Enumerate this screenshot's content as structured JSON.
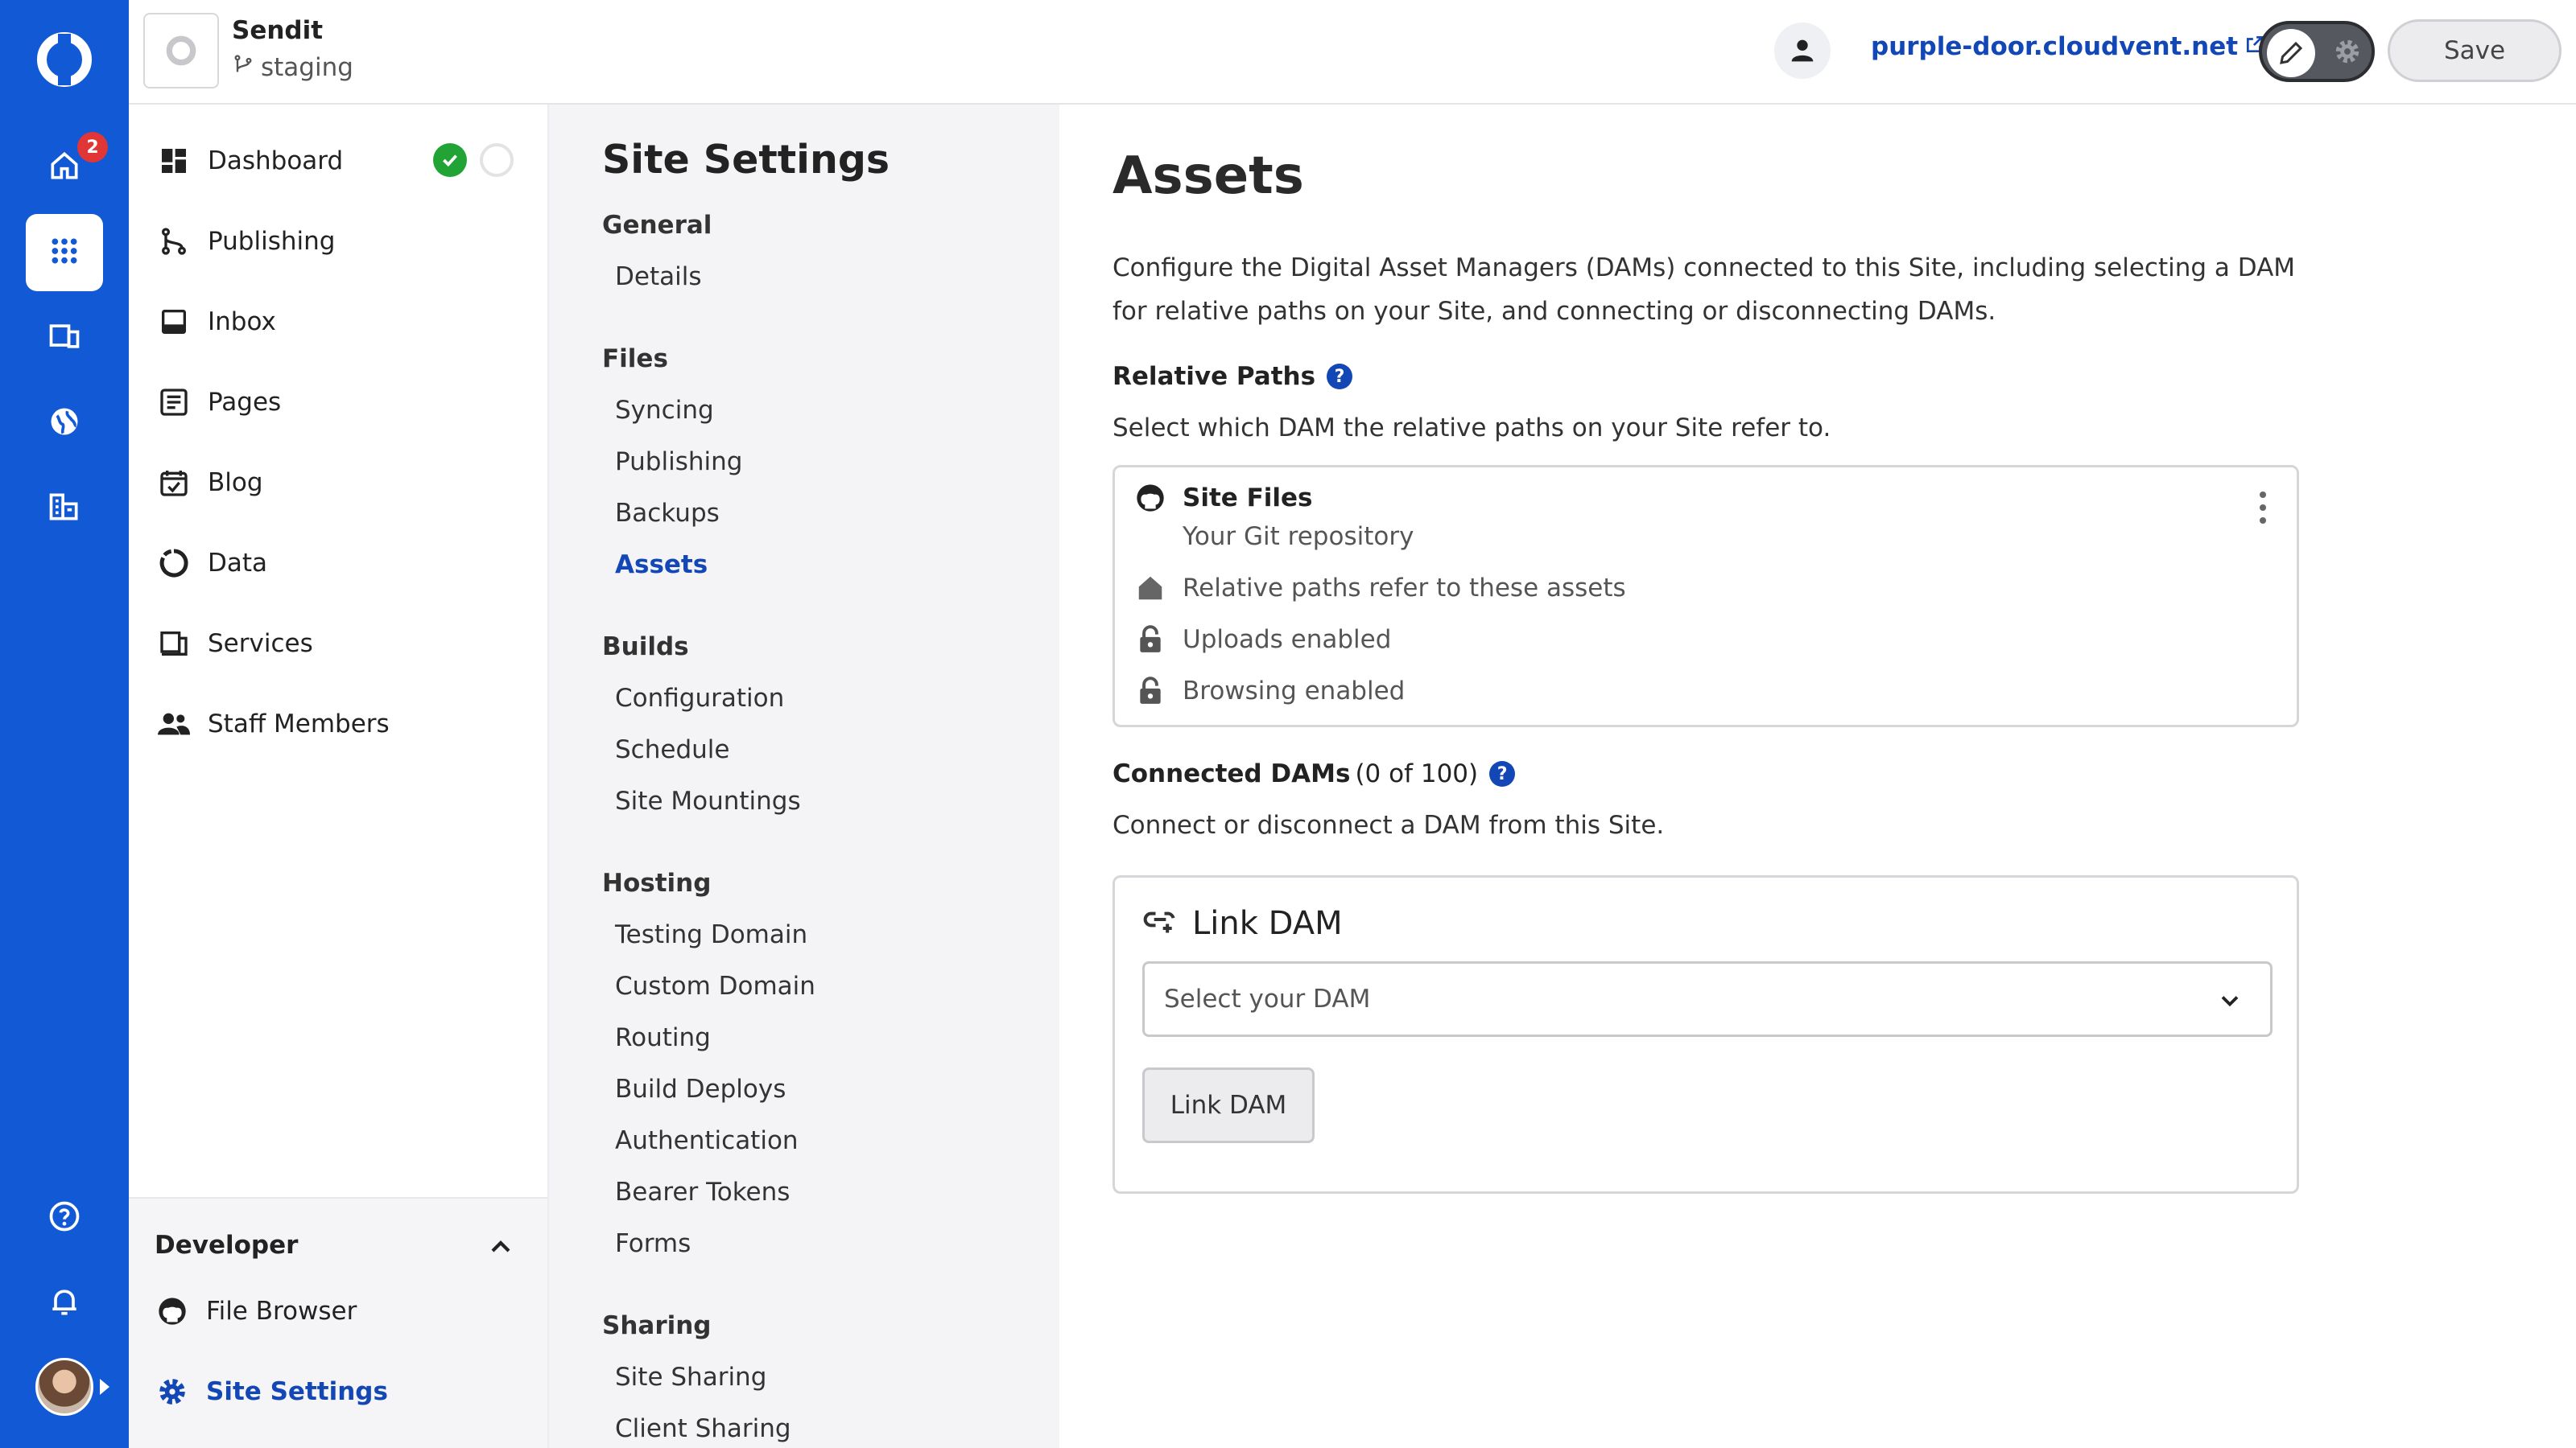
{
  "rail": {
    "notification_count": "2",
    "icons": [
      "logo-icon",
      "home-icon",
      "apps-grid-icon",
      "devices-icon",
      "globe-icon",
      "buildings-icon",
      "help-icon",
      "bell-icon"
    ]
  },
  "header": {
    "site_name": "Sendit",
    "branch": "staging",
    "domain": "purple-door.cloudvent.net",
    "save_label": "Save"
  },
  "nav": {
    "items": [
      {
        "label": "Dashboard",
        "icon": "dashboard-icon"
      },
      {
        "label": "Publishing",
        "icon": "branch-icon"
      },
      {
        "label": "Inbox",
        "icon": "inbox-icon"
      },
      {
        "label": "Pages",
        "icon": "pages-icon"
      },
      {
        "label": "Blog",
        "icon": "calendar-check-icon"
      },
      {
        "label": "Data",
        "icon": "data-icon"
      },
      {
        "label": "Services",
        "icon": "services-icon"
      },
      {
        "label": "Staff Members",
        "icon": "people-icon"
      }
    ],
    "developer": {
      "title": "Developer",
      "items": [
        {
          "label": "File Browser",
          "icon": "github-icon"
        },
        {
          "label": "Site Settings",
          "icon": "gear-icon"
        }
      ]
    }
  },
  "settings": {
    "title": "Site Settings",
    "sections": [
      {
        "heading": "General",
        "items": [
          "Details"
        ]
      },
      {
        "heading": "Files",
        "items": [
          "Syncing",
          "Publishing",
          "Backups",
          "Assets"
        ]
      },
      {
        "heading": "Builds",
        "items": [
          "Configuration",
          "Schedule",
          "Site Mountings"
        ]
      },
      {
        "heading": "Hosting",
        "items": [
          "Testing Domain",
          "Custom Domain",
          "Routing",
          "Build Deploys",
          "Authentication",
          "Bearer Tokens",
          "Forms"
        ]
      },
      {
        "heading": "Sharing",
        "items": [
          "Site Sharing",
          "Client Sharing"
        ]
      }
    ],
    "active": "Assets"
  },
  "main": {
    "title": "Assets",
    "description": "Configure the Digital Asset Managers (DAMs) connected to this Site, including selecting a DAM for relative paths on your Site, and connecting or disconnecting DAMs.",
    "relative_paths": {
      "label": "Relative Paths",
      "help": "?",
      "subtext": "Select which DAM the relative paths on your Site refer to.",
      "card": {
        "title": "Site Files",
        "subtitle": "Your Git repository",
        "rows": [
          "Relative paths refer to these assets",
          "Uploads enabled",
          "Browsing enabled"
        ]
      }
    },
    "connected": {
      "label": "Connected DAMs",
      "count": "(0 of 100)",
      "help": "?",
      "subtext": "Connect or disconnect a DAM from this Site."
    },
    "link_dam": {
      "title": "Link DAM",
      "select_placeholder": "Select your DAM",
      "button_label": "Link DAM"
    }
  }
}
